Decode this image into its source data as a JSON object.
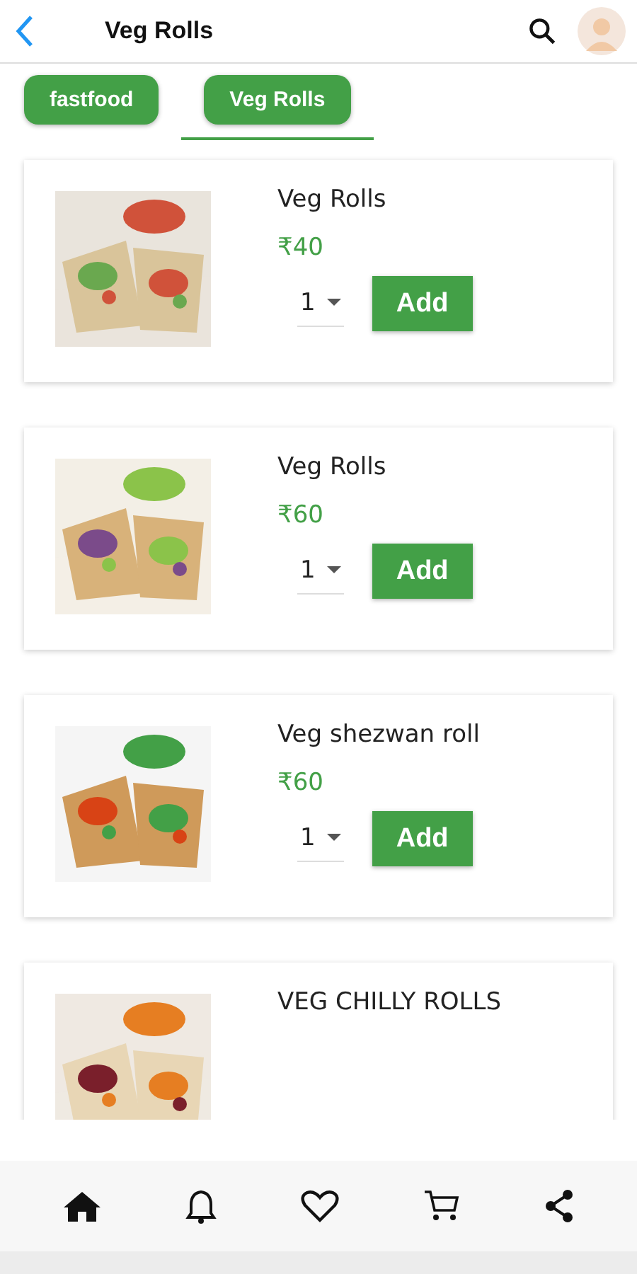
{
  "header": {
    "title": "Veg Rolls"
  },
  "tabs": [
    {
      "label": "fastfood",
      "selected": false
    },
    {
      "label": "Veg Rolls",
      "selected": true
    }
  ],
  "products": [
    {
      "name": "Veg Rolls",
      "price": "₹40",
      "quantity": "1",
      "button": "Add"
    },
    {
      "name": "Veg Rolls",
      "price": "₹60",
      "quantity": "1",
      "button": "Add"
    },
    {
      "name": "Veg shezwan roll",
      "price": "₹60",
      "quantity": "1",
      "button": "Add"
    },
    {
      "name": "VEG CHILLY ROLLS"
    }
  ]
}
